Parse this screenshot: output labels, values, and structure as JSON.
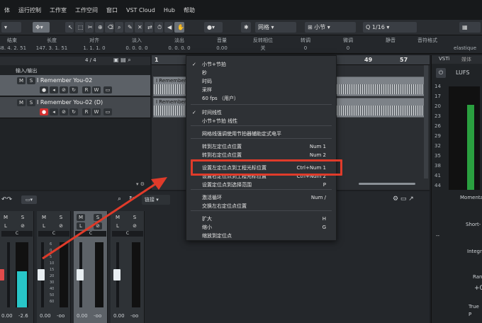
{
  "menubar": {
    "items": [
      "体",
      "运行控制",
      "工作室",
      "工作空间",
      "窗口",
      "VST Cloud",
      "Hub",
      "帮助"
    ]
  },
  "toolbar": {
    "snap_label": "网格",
    "grid_label": "小节",
    "quantize_label": "1/16"
  },
  "info_line": {
    "headers": [
      "结束",
      "长度",
      "对齐",
      "淡入",
      "淡出",
      "音量",
      "反转相位",
      "转调",
      "微调",
      "静音",
      "音符格式"
    ],
    "values": [
      "48. 4. 2. 51",
      "147. 3. 1. 51",
      "1. 1. 1. 0",
      "0. 0. 0. 0",
      "0. 0. 0. 0",
      "0.00",
      "关",
      "0",
      "0",
      "",
      ""
    ],
    "right_label": "elastique"
  },
  "tracklist": {
    "header_label": "输入/输出",
    "count": "4 / 4",
    "tracks": [
      {
        "name": "I Remember You-02",
        "m": "M",
        "s": "S",
        "r": "R",
        "w": "W"
      },
      {
        "name": "I Remember You-02 (D)",
        "m": "M",
        "s": "S",
        "r": "R",
        "w": "W"
      }
    ]
  },
  "ruler": {
    "marks": [
      "1",
      "49",
      "57"
    ]
  },
  "clips": [
    "I Remember Y",
    "I Remember Y"
  ],
  "context_menu": {
    "items": [
      {
        "label": "小节+节拍",
        "shortcut": "",
        "checked": true
      },
      {
        "label": "秒",
        "shortcut": "",
        "checked": false
      },
      {
        "label": "时码",
        "shortcut": "",
        "checked": false
      },
      {
        "label": "采样",
        "shortcut": "",
        "checked": false
      },
      {
        "label": "60 fps （用户）",
        "shortcut": "",
        "checked": false
      },
      {
        "label": "时间线性",
        "shortcut": "",
        "checked": true
      },
      {
        "label": "小节+节拍 线性",
        "shortcut": "",
        "checked": false
      },
      {
        "label": "网格线强调使用节拍器辅助定式电平",
        "shortcut": "",
        "checked": false
      },
      {
        "label": "转到左定位点位置",
        "shortcut": "Num 1",
        "checked": false
      },
      {
        "label": "转到右定位点位置",
        "shortcut": "Num 2",
        "checked": false
      },
      {
        "label": "设置左定位点到工程光标位置",
        "shortcut": "Ctrl+Num 1",
        "checked": false
      },
      {
        "label": "设置右定位点到工程光标位置",
        "shortcut": "Ctrl+Num 2",
        "checked": false
      },
      {
        "label": "设置定位点到选择范围",
        "shortcut": "P",
        "checked": false
      },
      {
        "label": "激活循环",
        "shortcut": "Num /",
        "checked": false
      },
      {
        "label": "交换左右定位点位置",
        "shortcut": "",
        "checked": false
      },
      {
        "label": "扩大",
        "shortcut": "H",
        "checked": false
      },
      {
        "label": "缩小",
        "shortcut": "G",
        "checked": false
      },
      {
        "label": "缩放到定位点",
        "shortcut": "",
        "checked": false
      }
    ]
  },
  "mixer": {
    "link_label": "链接",
    "channels": [
      {
        "m": "M",
        "s": "S",
        "l": "L",
        "vol": "0.00",
        "pan": "-2.6",
        "level": 0.55
      },
      {
        "m": "M",
        "s": "S",
        "l": "L",
        "vol": "0.00",
        "pan": "-oo",
        "level": 0.0
      },
      {
        "m": "M",
        "s": "S",
        "l": "L",
        "vol": "0.00",
        "pan": "-oo",
        "level": 0.0
      },
      {
        "m": "M",
        "s": "S",
        "l": "L",
        "vol": "0.00",
        "pan": "-oo",
        "level": 0.0
      }
    ],
    "scale": [
      "6",
      "0",
      "5",
      "10",
      "15",
      "20",
      "30",
      "40",
      "50",
      "60"
    ]
  },
  "meter_panel": {
    "tabs": [
      "VSTi",
      "媒体"
    ],
    "title": "LUFS",
    "scale": [
      "14",
      "17",
      "20",
      "23",
      "26",
      "29",
      "32",
      "35",
      "38",
      "41",
      "44"
    ],
    "labels": [
      "Momenta",
      "Short-",
      "Integr",
      "Ran",
      "+0",
      "True P"
    ],
    "dash": "--"
  },
  "colors": {
    "accent_red": "#e03b2a",
    "meter_fill": "#28c6c8",
    "rec_red": "#d43030"
  }
}
